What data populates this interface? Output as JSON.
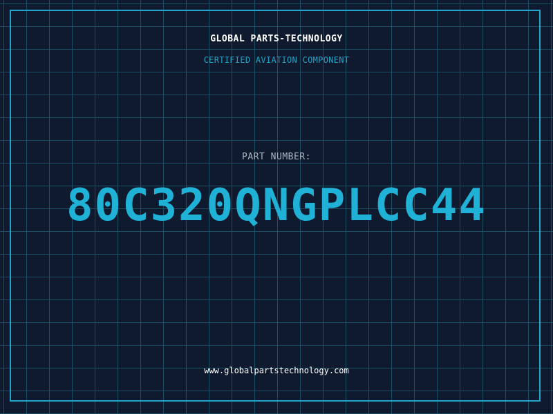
{
  "header": {
    "company": "GLOBAL PARTS-TECHNOLOGY",
    "tagline": "CERTIFIED AVIATION COMPONENT"
  },
  "part": {
    "label": "PART NUMBER:",
    "number": "80C320QNGPLCC44"
  },
  "footer": {
    "website": "www.globalpartstechnology.com"
  },
  "colors": {
    "background": "#101a2e",
    "grid": "#1d4f63",
    "accent": "#22a3c7",
    "part_number": "#1fb1d6"
  }
}
